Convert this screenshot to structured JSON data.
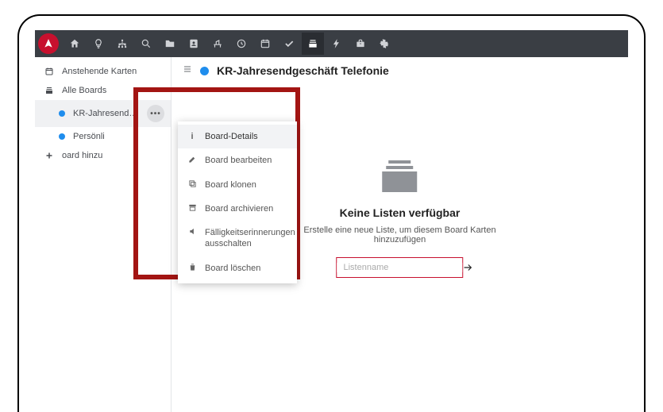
{
  "colors": {
    "brand_red": "#c7102e",
    "dot_blue": "#1f8ded"
  },
  "sidebar": {
    "items": [
      {
        "label": "Anstehende Karten"
      },
      {
        "label": "Alle Boards"
      }
    ],
    "boards": [
      {
        "label": "KR-Jahresendgeschäf...",
        "dot": "#1f8ded",
        "selected": true
      },
      {
        "label": "Persönli",
        "dot": "#1f8ded",
        "selected": false
      }
    ],
    "add_board": "oard hinzu"
  },
  "board": {
    "title": "KR-Jahresendgeschäft Telefonie",
    "dot": "#1f8ded"
  },
  "empty_state": {
    "title": "Keine Listen verfügbar",
    "subtitle": "Erstelle eine neue Liste, um diesem Board Karten hinzuzufügen",
    "input_placeholder": "Listenname"
  },
  "context_menu": {
    "items": [
      {
        "label": "Board-Details"
      },
      {
        "label": "Board bearbeiten"
      },
      {
        "label": "Board klonen"
      },
      {
        "label": "Board archivieren"
      },
      {
        "label": "Fälligkeitserinnerungen ausschalten"
      },
      {
        "label": "Board löschen"
      }
    ]
  }
}
